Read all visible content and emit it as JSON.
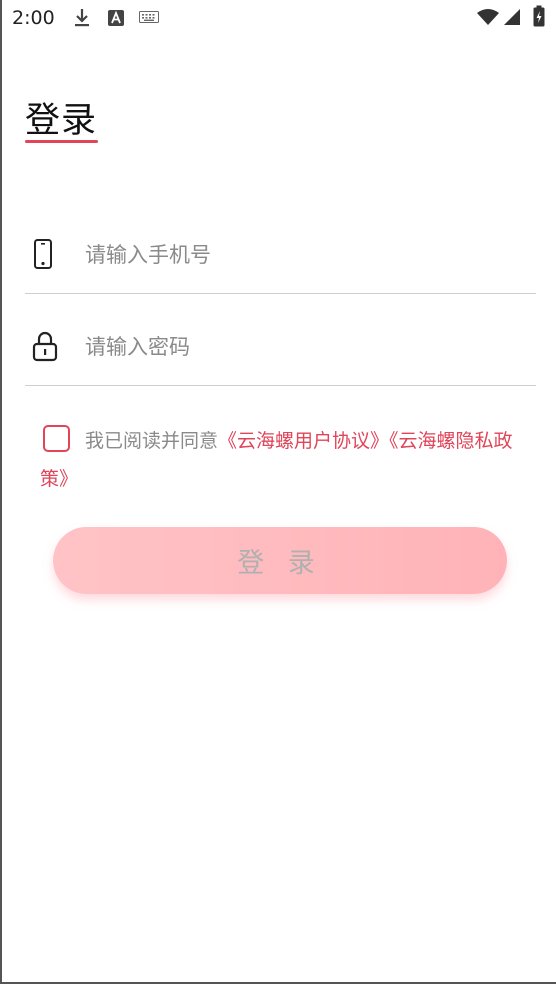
{
  "status_bar": {
    "time": "2:00",
    "icons": [
      "download-icon",
      "a-box-icon",
      "keyboard-icon",
      "wifi-icon",
      "signal-icon",
      "battery-icon"
    ]
  },
  "page": {
    "title": "登录",
    "accent_color": "#e0455a"
  },
  "form": {
    "phone": {
      "icon": "phone-icon",
      "value": "",
      "placeholder": "请输入手机号"
    },
    "password": {
      "icon": "lock-icon",
      "value": "",
      "placeholder": "请输入密码"
    }
  },
  "agreement": {
    "checked": false,
    "prefix": "我已阅读并同意",
    "user_agreement_link": "《云海螺用户协议》",
    "privacy_policy_link": "《云海螺隐私政策》"
  },
  "login_button": {
    "label": "登 录"
  }
}
